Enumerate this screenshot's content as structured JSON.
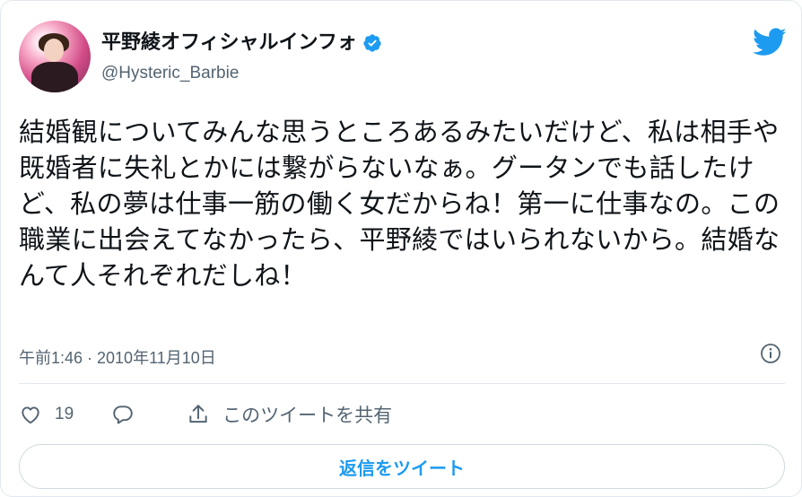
{
  "author": {
    "display_name": "平野綾オフィシャルインフォ",
    "handle": "@Hysteric_Barbie"
  },
  "tweet": {
    "text": "結婚観についてみんな思うところあるみたいだけど、私は相手や既婚者に失礼とかには繋がらないなぁ。グータンでも話したけど、私の夢は仕事一筋の働く女だからね！第一に仕事なの。この職業に出会えてなかったら、平野綾ではいられないから。結婚なんて人それぞれだしね！",
    "timestamp": "午前1:46 · 2010年11月10日"
  },
  "actions": {
    "like_count": "19",
    "share_label": "このツイートを共有"
  },
  "reply_button": {
    "label": "返信をツイート"
  },
  "colors": {
    "brand_blue": "#1d9bf0",
    "muted": "#536471"
  },
  "icons": [
    "avatar",
    "verified-badge-icon",
    "twitter-bird-icon",
    "info-icon",
    "heart-icon",
    "reply-bubble-icon",
    "share-icon"
  ]
}
